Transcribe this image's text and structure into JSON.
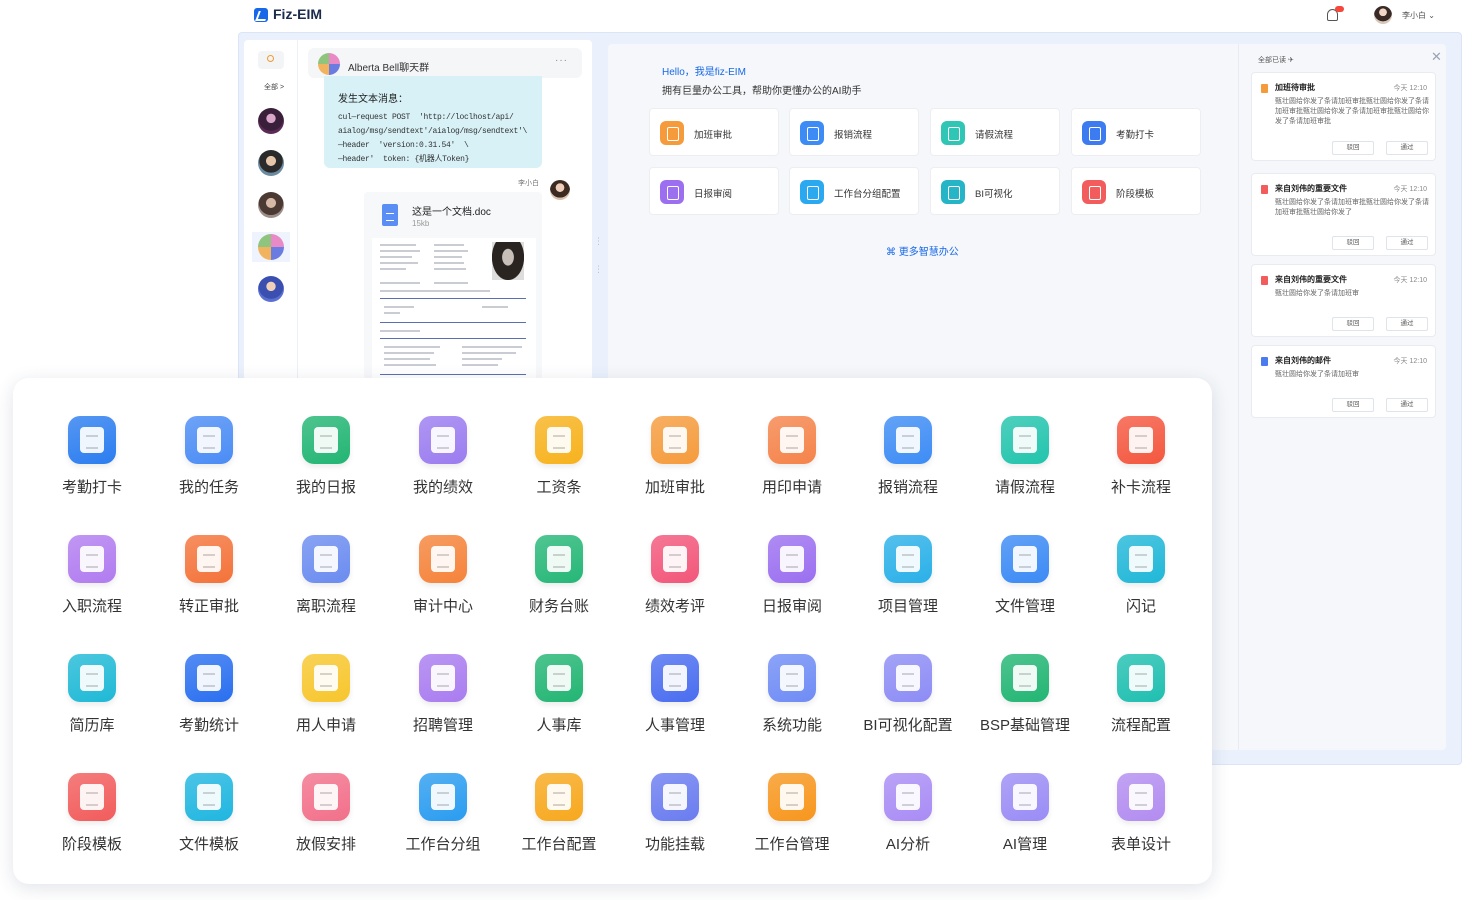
{
  "colors": {
    "primary": "#1768e8",
    "frame": "#eaf1fc",
    "bubble": "#d7f1f6"
  },
  "header": {
    "brand": "Fiz-EIM",
    "user": "李小白 ⌄",
    "icons": [
      "logo-icon",
      "bell-icon",
      "user-avatar"
    ]
  },
  "chat": {
    "all_label": "全部 >",
    "group_name": "Alberta Bell聊天群",
    "more": "···",
    "bubble_title": "发生文本消息：",
    "bubble_code": "cul—request POST  'http://loclhost/api/\naialog/msg/sendtext'/aialog/msg/sendtext'\\\n—header  'version:0.31.54'  \\\n—header'  token: {机器人Token}",
    "sender": "李小白",
    "doc_name": "这是一个文档.doc",
    "doc_size": "15kb",
    "contacts": [
      "contact-1",
      "contact-2",
      "contact-3",
      "contact-group",
      "contact-5"
    ]
  },
  "assistant": {
    "hello": "Hello，我是fiz-EIM",
    "subtitle": "拥有巨量办公工具，帮助你更懂办公的AI助手",
    "quick": [
      {
        "label": "加班审批",
        "color": "#f59b3c"
      },
      {
        "label": "报销流程",
        "color": "#3d8cf5"
      },
      {
        "label": "请假流程",
        "color": "#2fc6b6"
      },
      {
        "label": "考勤打卡",
        "color": "#3d7cf0"
      },
      {
        "label": "日报审阅",
        "color": "#9b6ff0"
      },
      {
        "label": "工作台分组配置",
        "color": "#2aa8f0"
      },
      {
        "label": "BI可视化",
        "color": "#25b5c7"
      },
      {
        "label": "阶段模板",
        "color": "#f25c5c"
      }
    ],
    "more_link": "⌘ 更多智慧办公"
  },
  "notifications": {
    "read_all": "全部已读 ✈",
    "close": "✕",
    "items": [
      {
        "title": "加班待审批",
        "time": "今天  12:10",
        "body": "甄壮圆给你发了条请加班审批甄壮圆给你发了条请加班审批甄壮圆给你发了条请加班审批甄壮圆给你发了条请加班审批",
        "reject": "驳回",
        "approve": "通过",
        "color": "#f59b3c"
      },
      {
        "title": "来自刘伟的重要文件",
        "time": "今天  12:10",
        "body": "甄壮圆给你发了条请加班审批甄壮圆给你发了条请加班审批甄壮圆给你发了",
        "reject": "驳回",
        "approve": "通过",
        "color": "#f25c5c"
      },
      {
        "title": "来自刘伟的重要文件",
        "time": "今天  12:10",
        "body": "甄壮圆给你发了条请加班审",
        "reject": "驳回",
        "approve": "通过",
        "color": "#f25c5c"
      },
      {
        "title": "来自刘伟的邮件",
        "time": "今天  12:10",
        "body": "甄壮圆给你发了条请加班审",
        "reject": "驳回",
        "approve": "通过",
        "color": "#4a7cf0"
      }
    ]
  },
  "apps": [
    {
      "label": "考勤打卡",
      "icon": "clock-in-icon",
      "color": "#2b7df0"
    },
    {
      "label": "我的任务",
      "icon": "task-icon",
      "color": "#4a8cf5"
    },
    {
      "label": "我的日报",
      "icon": "daily-report-icon",
      "color": "#22b573"
    },
    {
      "label": "我的绩效",
      "icon": "performance-icon",
      "color": "#9b7cf0"
    },
    {
      "label": "工资条",
      "icon": "payslip-icon",
      "color": "#f7b21d"
    },
    {
      "label": "加班审批",
      "icon": "overtime-icon",
      "color": "#f59b3c"
    },
    {
      "label": "用印申请",
      "icon": "seal-icon",
      "color": "#f5834a"
    },
    {
      "label": "报销流程",
      "icon": "reimburse-icon",
      "color": "#3d8cf5"
    },
    {
      "label": "请假流程",
      "icon": "leave-icon",
      "color": "#22c4ad"
    },
    {
      "label": "补卡流程",
      "icon": "makeup-card-icon",
      "color": "#f4573f"
    },
    {
      "label": "入职流程",
      "icon": "onboarding-icon",
      "color": "#b17cf0"
    },
    {
      "label": "转正审批",
      "icon": "regularize-icon",
      "color": "#f4733a"
    },
    {
      "label": "离职流程",
      "icon": "resign-icon",
      "color": "#6b8cf0"
    },
    {
      "label": "审计中心",
      "icon": "audit-icon",
      "color": "#f5833a"
    },
    {
      "label": "财务台账",
      "icon": "ledger-icon",
      "color": "#26b777"
    },
    {
      "label": "绩效考评",
      "icon": "evaluation-icon",
      "color": "#f2567a"
    },
    {
      "label": "日报审阅",
      "icon": "review-icon",
      "color": "#9b6ff0"
    },
    {
      "label": "项目管理",
      "icon": "project-icon",
      "color": "#2ab0e8"
    },
    {
      "label": "文件管理",
      "icon": "folder-icon",
      "color": "#3b8af5"
    },
    {
      "label": "闪记",
      "icon": "flash-note-icon",
      "color": "#20b7d8"
    },
    {
      "label": "简历库",
      "icon": "resume-icon",
      "color": "#1fb9d6"
    },
    {
      "label": "考勤统计",
      "icon": "fingerprint-icon",
      "color": "#2a6ff0"
    },
    {
      "label": "用人申请",
      "icon": "hire-request-icon",
      "color": "#f7c62d"
    },
    {
      "label": "招聘管理",
      "icon": "recruit-icon",
      "color": "#a97cf0"
    },
    {
      "label": "人事库",
      "icon": "staff-db-icon",
      "color": "#22b573"
    },
    {
      "label": "人事管理",
      "icon": "hr-manage-icon",
      "color": "#4a6df0"
    },
    {
      "label": "系统功能",
      "icon": "system-icon",
      "color": "#6f8cf5"
    },
    {
      "label": "BI可视化配置",
      "icon": "bi-config-icon",
      "color": "#8d8cf5"
    },
    {
      "label": "BSP基础管理",
      "icon": "bsp-icon",
      "color": "#22b573"
    },
    {
      "label": "流程配置",
      "icon": "flow-config-icon",
      "color": "#1fbfb0"
    },
    {
      "label": "阶段模板",
      "icon": "stage-template-icon",
      "color": "#f25c5c"
    },
    {
      "label": "文件模板",
      "icon": "file-template-icon",
      "color": "#1fb6e0"
    },
    {
      "label": "放假安排",
      "icon": "holiday-icon",
      "color": "#f2708a"
    },
    {
      "label": "工作台分组",
      "icon": "workbench-group-icon",
      "color": "#2a9cf0"
    },
    {
      "label": "工作台配置",
      "icon": "workbench-config-icon",
      "color": "#f7a81d"
    },
    {
      "label": "功能挂载",
      "icon": "mount-icon",
      "color": "#6a7cf0"
    },
    {
      "label": "工作台管理",
      "icon": "workbench-manage-icon",
      "color": "#f7961d"
    },
    {
      "label": "AI分析",
      "icon": "ai-analysis-icon",
      "color": "#a98cf5"
    },
    {
      "label": "AI管理",
      "icon": "ai-manage-icon",
      "color": "#9a8cf5"
    },
    {
      "label": "表单设计",
      "icon": "form-design-icon",
      "color": "#b28cf0"
    }
  ]
}
